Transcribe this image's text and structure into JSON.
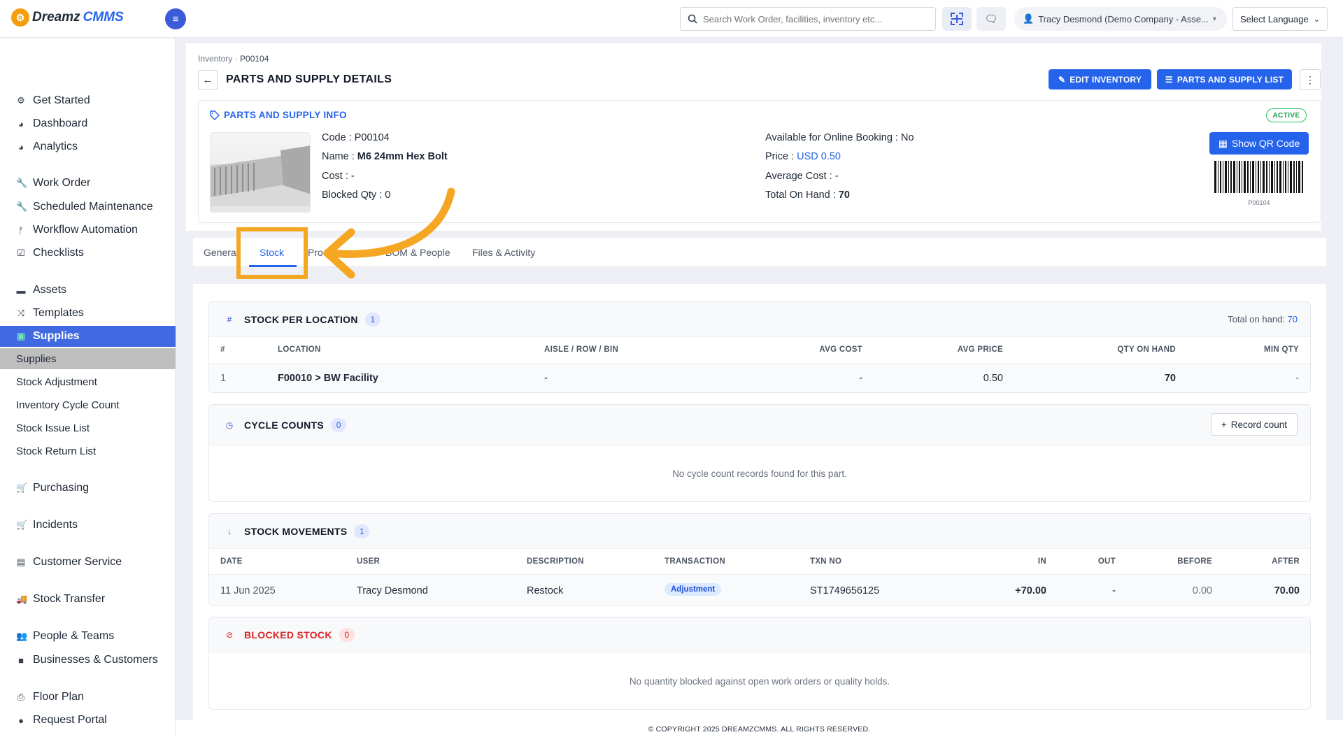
{
  "app": {
    "logo_part1": "Dreamz",
    "logo_part2": "CMMS"
  },
  "header": {
    "search_placeholder": "Search Work Order, facilities, inventory etc...",
    "user_label": "Tracy Desmond (Demo Company - Asse...",
    "language_label": "Select Language"
  },
  "sidebar": {
    "items": [
      {
        "label": "Get Started",
        "icon": "gears-icon"
      },
      {
        "label": "Dashboard",
        "icon": "dashboard-icon"
      },
      {
        "label": "Analytics",
        "icon": "analytics-icon"
      },
      {
        "label": "Work Order",
        "icon": "wrench-icon"
      },
      {
        "label": "Scheduled Maintenance",
        "icon": "wrench-icon"
      },
      {
        "label": "Workflow Automation",
        "icon": "branch-icon"
      },
      {
        "label": "Checklists",
        "icon": "checkbox-icon"
      },
      {
        "label": "Assets",
        "icon": "box-icon"
      },
      {
        "label": "Templates",
        "icon": "shuffle-icon"
      },
      {
        "label": "Supplies",
        "icon": "supplies-icon"
      },
      {
        "label": "Purchasing",
        "icon": "cart-icon"
      },
      {
        "label": "Incidents",
        "icon": "cart-icon"
      },
      {
        "label": "Customer Service",
        "icon": "file-icon"
      },
      {
        "label": "Stock Transfer",
        "icon": "truck-icon"
      },
      {
        "label": "People & Teams",
        "icon": "users-icon"
      },
      {
        "label": "Businesses & Customers",
        "icon": "video-icon"
      },
      {
        "label": "Floor Plan",
        "icon": "print-icon"
      },
      {
        "label": "Request Portal",
        "icon": "chat-icon"
      }
    ],
    "subitems": [
      "Supplies",
      "Stock Adjustment",
      "Inventory Cycle Count",
      "Stock Issue List",
      "Stock Return List"
    ]
  },
  "breadcrumb": {
    "parent": "Inventory",
    "current": "P00104"
  },
  "page": {
    "title": "PARTS AND SUPPLY DETAILS",
    "edit_button": "EDIT INVENTORY",
    "list_button": "PARTS AND SUPPLY LIST"
  },
  "info": {
    "heading": "PARTS AND SUPPLY INFO",
    "status": "ACTIVE",
    "code_label": "Code : ",
    "code": "P00104",
    "name_label": "Name : ",
    "name": "M6 24mm Hex Bolt",
    "cost_label": "Cost : ",
    "cost": "-",
    "blocked_label": "Blocked Qty : ",
    "blocked": "0",
    "online_label": "Available for Online Booking : ",
    "online": "No",
    "price_label": "Price : ",
    "price": "USD 0.50",
    "avg_cost_label": "Average Cost : ",
    "avg_cost": "-",
    "onhand_label": "Total On Hand : ",
    "onhand": "70",
    "qr_button": "Show QR Code",
    "barcode_text": "P00104"
  },
  "tabs": [
    "Genera",
    "Stock",
    "Proc",
    "BOM & People",
    "Files & Activity"
  ],
  "stock_per_location": {
    "title": "STOCK PER LOCATION",
    "count": "1",
    "total_label": "Total on hand: ",
    "total": "70",
    "columns": [
      "#",
      "LOCATION",
      "AISLE / ROW / BIN",
      "AVG COST",
      "AVG PRICE",
      "QTY ON HAND",
      "MIN QTY"
    ],
    "rows": [
      [
        "1",
        "F00010 > BW Facility",
        "-",
        "-",
        "0.50",
        "70",
        "-"
      ]
    ]
  },
  "cycle_counts": {
    "title": "CYCLE COUNTS",
    "count": "0",
    "record_button": "Record count",
    "empty": "No cycle count records found for this part."
  },
  "stock_movements": {
    "title": "STOCK MOVEMENTS",
    "count": "1",
    "columns": [
      "DATE",
      "USER",
      "DESCRIPTION",
      "TRANSACTION",
      "TXN NO",
      "IN",
      "OUT",
      "BEFORE",
      "AFTER"
    ],
    "rows": [
      [
        "11 Jun 2025",
        "Tracy Desmond",
        "Restock",
        "Adjustment",
        "ST1749656125",
        "+70.00",
        "-",
        "0.00",
        "70.00"
      ]
    ]
  },
  "blocked_stock": {
    "title": "BLOCKED STOCK",
    "count": "0",
    "empty": "No quantity blocked against open work orders or quality holds."
  },
  "footer": "© COPYRIGHT 2025 DREAMZCMMS. ALL RIGHTS RESERVED.",
  "colors": {
    "accent": "#2563eb",
    "highlight": "#f5a623",
    "sidebar_active": "#4169e1"
  }
}
